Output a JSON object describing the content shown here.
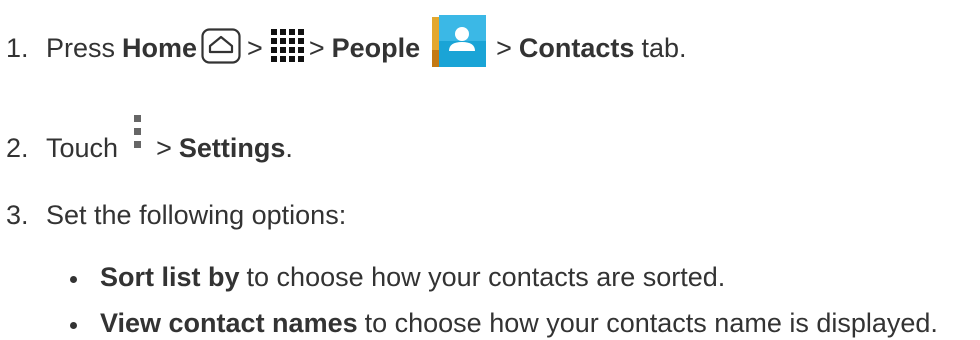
{
  "steps": [
    {
      "number": "1.",
      "press": "Press",
      "home": "Home",
      "sep1": ">",
      "sep2": ">",
      "people": "People",
      "sep3": ">",
      "contacts": "Contacts",
      "tab": "tab."
    },
    {
      "number": "2.",
      "touch": "Touch",
      "sep": ">",
      "settings": "Settings",
      "period": "."
    },
    {
      "number": "3.",
      "text": "Set the following options:"
    }
  ],
  "options": [
    {
      "term": "Sort list by",
      "desc": "to choose how your contacts are sorted."
    },
    {
      "term": "View contact names",
      "desc": "to choose how your contacts name is displayed."
    }
  ],
  "icons": {
    "home": "home-key-icon",
    "apps": "apps-grid-icon",
    "people": "people-app-icon",
    "menu": "menu-dots-icon"
  },
  "colors": {
    "text": "#333333",
    "people_icon_blue": "#1aa4d6",
    "people_icon_tab": "#e3a82e"
  }
}
